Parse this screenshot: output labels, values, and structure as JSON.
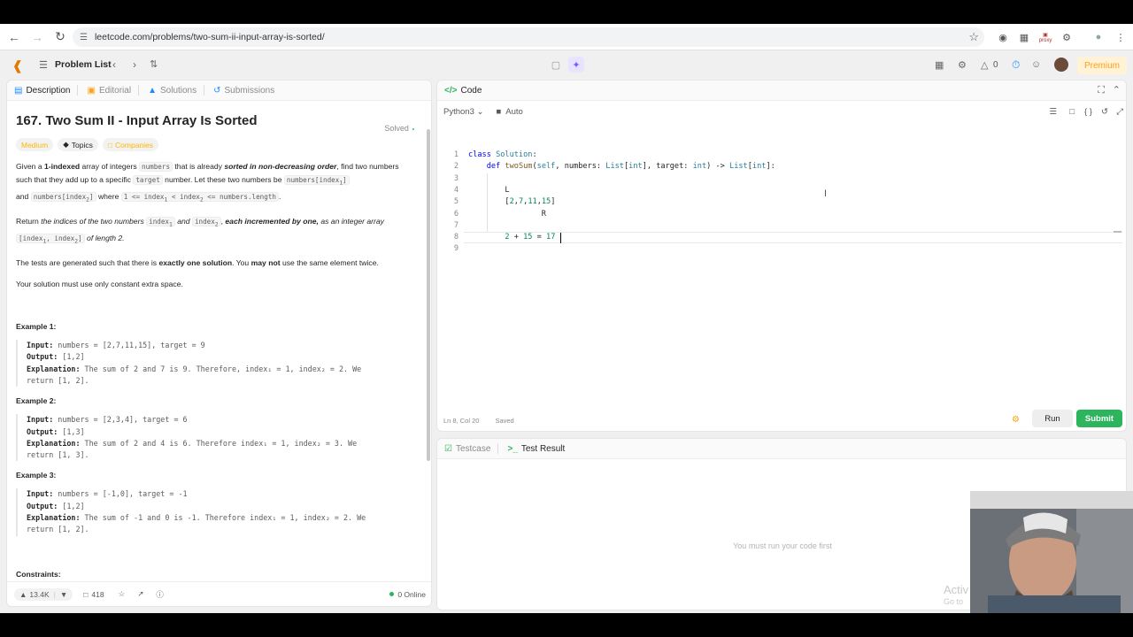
{
  "browser": {
    "url": "leetcode.com/problems/two-sum-ii-input-array-is-sorted/",
    "ext_proxy_label": "proxy"
  },
  "nav": {
    "problem_list": "Problem List",
    "streak_count": "0",
    "premium": "Premium"
  },
  "left_tabs": {
    "description": "Description",
    "editorial": "Editorial",
    "solutions": "Solutions",
    "submissions": "Submissions"
  },
  "problem": {
    "title": "167. Two Sum II - Input Array Is Sorted",
    "status": "Solved",
    "difficulty": "Medium",
    "topics": "Topics",
    "companies": "Companies",
    "p1": {
      "a": "Given a ",
      "b": "1-indexed",
      "c": " array of integers ",
      "d": "numbers",
      "e": " that is already ",
      "f": "sorted in non-decreasing order",
      "g": ", find two numbers such that they add up to a specific ",
      "h": "target",
      "i": " number. Let these two numbers be ",
      "j": "numbers[index",
      "j2": "1",
      "j3": "]",
      "k": " and ",
      "l": "numbers[index",
      "l2": "2",
      "l3": "]",
      "m": " where ",
      "n": "1 <= index",
      "n2": "1",
      "n3": " < index",
      "n4": "2",
      "n5": " <= numbers.length",
      "o": "."
    },
    "p2": {
      "a": "Return ",
      "b": "the indices of the two numbers ",
      "c": "index",
      "c2": "1",
      "d": " and ",
      "e": "index",
      "e2": "2",
      "f": ", ",
      "g": "each incremented by one,",
      "h": " as an integer array ",
      "i": "[index",
      "i2": "1",
      "i3": ", index",
      "i4": "2",
      "i5": "]",
      "j": " of length 2."
    },
    "p3": {
      "a": "The tests are generated such that there is ",
      "b": "exactly one solution",
      "c": ". You ",
      "d": "may not",
      "e": " use the same element twice."
    },
    "p4": "Your solution must use only constant extra space.",
    "examples": [
      {
        "heading": "Example 1:",
        "input_label": "Input:",
        "input": " numbers = [2,7,11,15], target = 9",
        "output_label": "Output:",
        "output": " [1,2]",
        "expl_label": "Explanation:",
        "expl1": " The sum of 2 and 7 is 9. Therefore, index₁ = 1, index₂ = 2. We",
        "expl2": "return [1, 2]."
      },
      {
        "heading": "Example 2:",
        "input_label": "Input:",
        "input": " numbers = [2,3,4], target = 6",
        "output_label": "Output:",
        "output": " [1,3]",
        "expl_label": "Explanation:",
        "expl1": " The sum of 2 and 4 is 6. Therefore index₁ = 1, index₂ = 3. We",
        "expl2": "return [1, 3]."
      },
      {
        "heading": "Example 3:",
        "input_label": "Input:",
        "input": " numbers = [-1,0], target = -1",
        "output_label": "Output:",
        "output": " [1,2]",
        "expl_label": "Explanation:",
        "expl1": " The sum of -1 and 0 is -1. Therefore index₁ = 1, index₂ = 2. We",
        "expl2": "return [1, 2]."
      }
    ],
    "constraints": "Constraints:"
  },
  "bottom_bar": {
    "likes": "13.4K",
    "comments": "418",
    "online": "0 Online"
  },
  "code_panel": {
    "title": "Code",
    "language": "Python3",
    "mode": "Auto",
    "status_left": "Ln 8, Col 20",
    "status_saved": "Saved",
    "run": "Run",
    "submit": "Submit"
  },
  "code_lines": [
    {
      "n": "1",
      "text": "class Solution:"
    },
    {
      "n": "2",
      "text": "    def twoSum(self, numbers: List[int], target: int) -> List[int]:"
    },
    {
      "n": "3",
      "text": ""
    },
    {
      "n": "4",
      "text": "        L"
    },
    {
      "n": "5",
      "text": "        [2,7,11,15]"
    },
    {
      "n": "6",
      "text": "                R"
    },
    {
      "n": "7",
      "text": ""
    },
    {
      "n": "8",
      "text": "        2 + 15 = 17"
    },
    {
      "n": "9",
      "text": ""
    }
  ],
  "test_panel": {
    "testcase": "Testcase",
    "test_result": "Test Result",
    "empty": "You must run your code first"
  },
  "watermark": {
    "line1": "Activ",
    "line2": "Go to"
  }
}
